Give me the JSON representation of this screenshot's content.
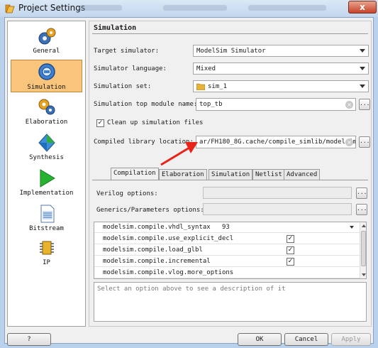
{
  "window": {
    "title": "Project Settings",
    "close_glyph": "x"
  },
  "nav": {
    "items": [
      {
        "label": "General",
        "icon": "general-icon",
        "selected": false
      },
      {
        "label": "Simulation",
        "icon": "simulation-magnifier-icon",
        "selected": true
      },
      {
        "label": "Elaboration",
        "icon": "elaboration-gears-icon",
        "selected": false
      },
      {
        "label": "Synthesis",
        "icon": "synthesis-diamond-icon",
        "selected": false
      },
      {
        "label": "Implementation",
        "icon": "implementation-play-icon",
        "selected": false
      },
      {
        "label": "Bitstream",
        "icon": "bitstream-file-icon",
        "selected": false
      },
      {
        "label": "IP",
        "icon": "ip-chip-icon",
        "selected": false
      }
    ]
  },
  "simulation": {
    "section_title": "Simulation",
    "target_simulator_label": "Target simulator:",
    "target_simulator_value": "ModelSim Simulator",
    "simulator_language_label": "Simulator language:",
    "simulator_language_value": "Mixed",
    "simulation_set_label": "Simulation set:",
    "simulation_set_value": "sim_1",
    "top_module_label": "Simulation top module name:",
    "top_module_value": "top_tb",
    "cleanup_label": "Clean up simulation files",
    "cleanup_checked": true,
    "compiled_lib_label": "Compiled library location:",
    "compiled_lib_value": "ar/FH180_8G.cache/compile_simlib/modelsim",
    "dots_label": "..."
  },
  "tabs": {
    "items": [
      "Compilation",
      "Elaboration",
      "Simulation",
      "Netlist",
      "Advanced"
    ],
    "active": "Compilation"
  },
  "compilation": {
    "verilog_options_label": "Verilog options:",
    "verilog_options_value": "",
    "generics_label": "Generics/Parameters options:",
    "generics_value": "",
    "properties": [
      {
        "name": "modelsim.compile.vhdl_syntax",
        "value": "93",
        "type": "dropdown"
      },
      {
        "name": "modelsim.compile.use_explicit_decl",
        "value": "✓",
        "type": "checkbox"
      },
      {
        "name": "modelsim.compile.load_glbl",
        "value": "✓",
        "type": "checkbox"
      },
      {
        "name": "modelsim.compile.incremental",
        "value": "✓",
        "type": "checkbox"
      },
      {
        "name": "modelsim.compile.vlog.more_options",
        "value": "",
        "type": "text"
      }
    ],
    "description": "Select an option above to see a description of it"
  },
  "footer": {
    "help_label": "?",
    "ok_label": "OK",
    "cancel_label": "Cancel",
    "apply_label": "Apply"
  },
  "colors": {
    "selected_nav": "#f9c57c",
    "annotation_arrow": "#e8231a",
    "close_button": "#c7432a"
  }
}
